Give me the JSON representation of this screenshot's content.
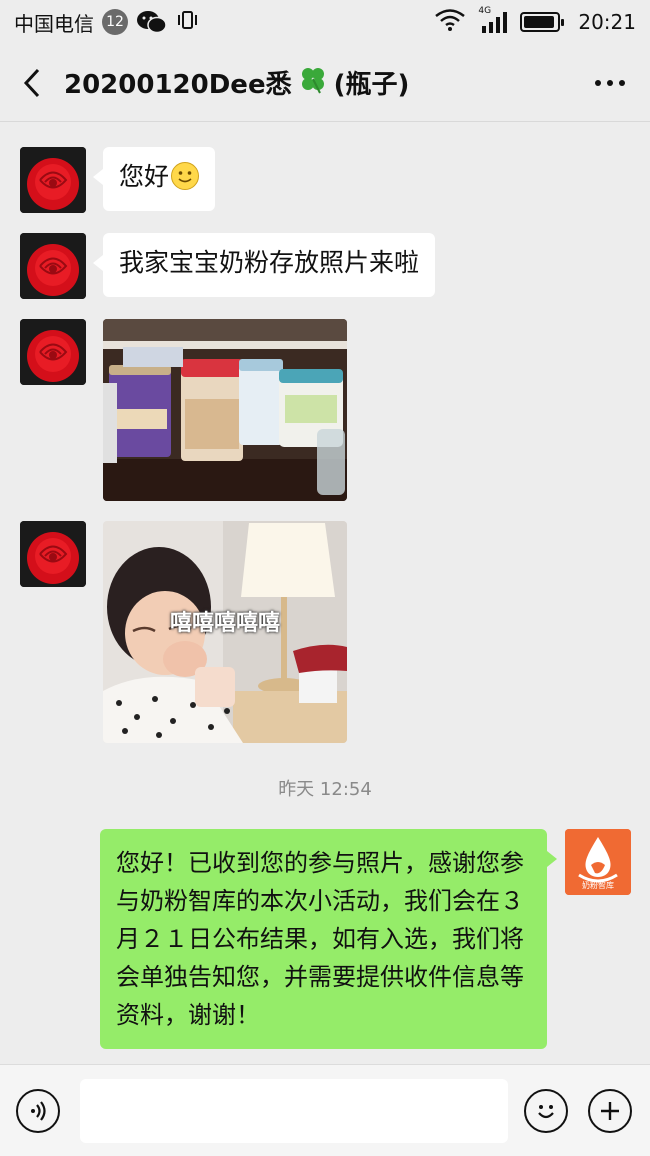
{
  "status_bar": {
    "carrier": "中国电信",
    "notification_count": "12",
    "network": "4G",
    "time": "20:21"
  },
  "navbar": {
    "title": "20200120Dee悉",
    "title_suffix": "(瓶子)",
    "title_icon": "four-leaf-clover",
    "back_icon": "chevron-left-icon",
    "more_icon": "more-dots-icon"
  },
  "messages": [
    {
      "sender": "contact",
      "type": "text",
      "text": "您好",
      "emoji": "smiling-face"
    },
    {
      "sender": "contact",
      "type": "text",
      "text": "我家宝宝奶粉存放照片来啦"
    },
    {
      "sender": "contact",
      "type": "image",
      "subject": "milk-powder-cans-photo"
    },
    {
      "sender": "contact",
      "type": "sticker",
      "caption": "嘻嘻嘻嘻嘻"
    },
    {
      "sender": "self",
      "type": "text",
      "text": "您好！已收到您的参与照片，感谢您参与奶粉智库的本次小活动，我们会在３月２１日公布结果，如有入选，我们将会单独告知您，并需要提供收件信息等资料，谢谢！"
    }
  ],
  "timestamp": "昨天 12:54",
  "self_avatar": {
    "logo_text": "奶粉智库"
  },
  "input_bar": {
    "voice_icon": "voice-icon",
    "emoji_icon": "emoji-icon",
    "plus_icon": "plus-icon",
    "placeholder": ""
  },
  "colors": {
    "background": "#ededed",
    "self_bubble": "#95ec69",
    "contact_bubble": "#ffffff",
    "self_avatar": "#f06a33"
  }
}
